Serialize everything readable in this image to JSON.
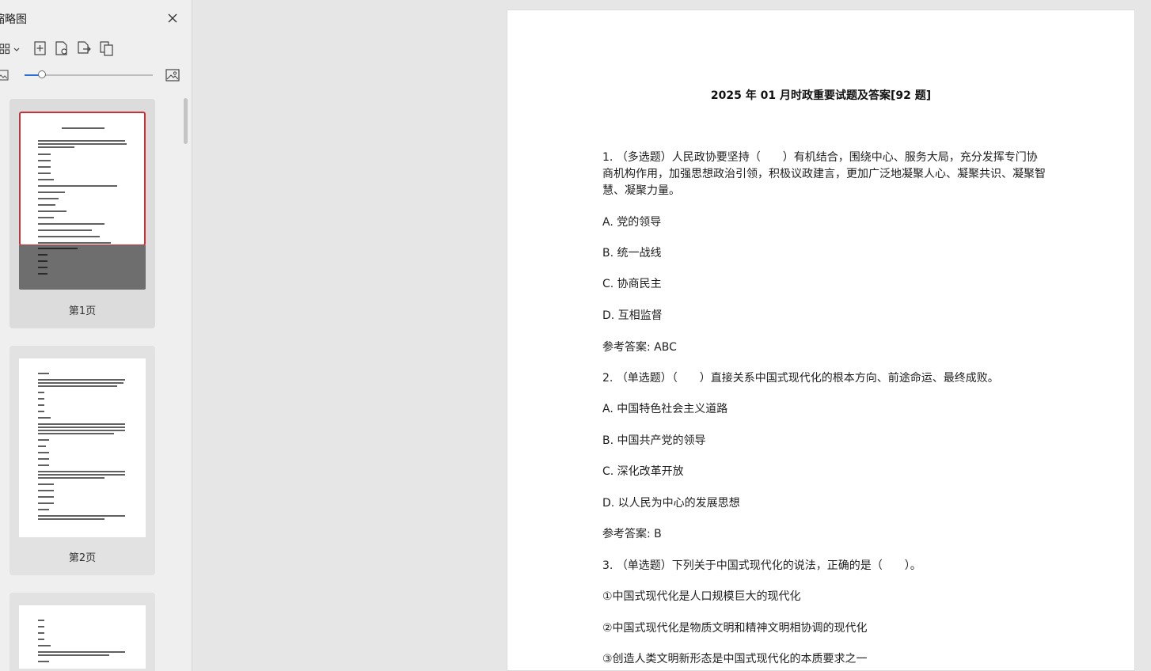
{
  "sidebar": {
    "title": "缩略图",
    "thumbnails": [
      {
        "label": "第1页"
      },
      {
        "label": "第2页"
      },
      {
        "label": ""
      }
    ],
    "zoom_level_percent": 14
  },
  "document": {
    "title": "2025 年 01 月时政重要试题及答案[92 题]",
    "paragraphs": [
      "1. （多选题）人民政协要坚持（　　）有机结合，围绕中心、服务大局，充分发挥专门协商机构作用，加强思想政治引领，积极议政建言，更加广泛地凝聚人心、凝聚共识、凝聚智慧、凝聚力量。",
      "A. 党的领导",
      "B. 统一战线",
      "C. 协商民主",
      "D. 互相监督",
      "参考答案: ABC",
      "2. （单选题）（　　）直接关系中国式现代化的根本方向、前途命运、最终成败。",
      "A. 中国特色社会主义道路",
      "B. 中国共产党的领导",
      "C. 深化改革开放",
      "D. 以人民为中心的发展思想",
      "参考答案: B",
      "3. （单选题）下列关于中国式现代化的说法，正确的是（　　）。",
      "①中国式现代化是人口规模巨大的现代化",
      "②中国式现代化是物质文明和精神文明相协调的现代化",
      "③创造人类文明新形态是中国式现代化的本质要求之一"
    ]
  }
}
